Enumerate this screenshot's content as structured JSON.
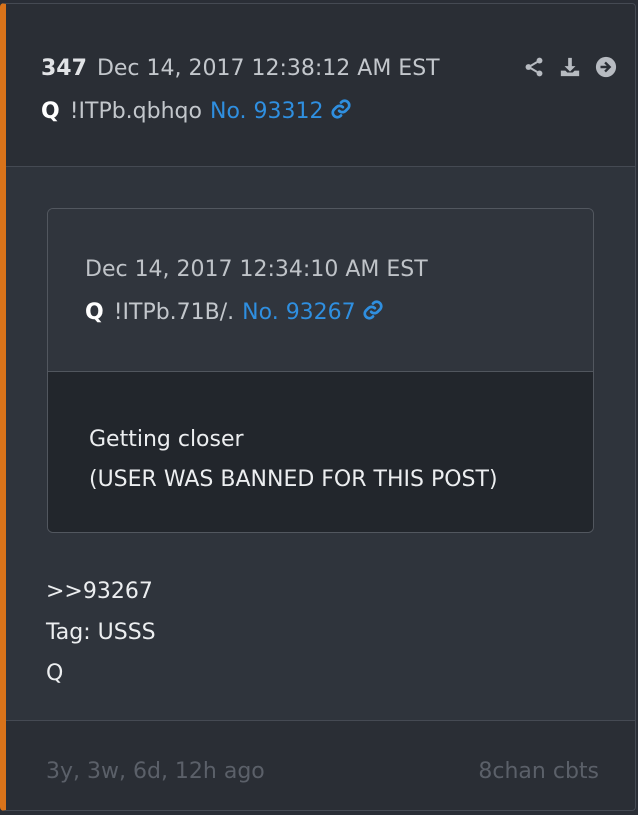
{
  "post": {
    "number": "347",
    "date": "Dec 14, 2017 12:38:12 AM EST",
    "author": "Q",
    "tripcode": "!ITPb.qbhqo",
    "post_no": "No. 93312",
    "icons": [
      "share-icon",
      "download-icon",
      "arrow-circle-right-icon",
      "link-icon"
    ]
  },
  "quote": {
    "date": "Dec 14, 2017 12:34:10 AM EST",
    "author": "Q",
    "tripcode": "!ITPb.71B/.",
    "post_no": "No. 93267",
    "lines": [
      "Getting closer",
      "(USER WAS BANNED FOR THIS POST)"
    ]
  },
  "body": {
    "lines": [
      ">>93267",
      "Tag: USSS",
      "Q"
    ]
  },
  "footer": {
    "age": "3y, 3w, 6d, 12h ago",
    "source": "8chan cbts"
  },
  "colors": {
    "accent": "#d9731a",
    "link": "#2f8fe0",
    "background": "#2f343c"
  }
}
